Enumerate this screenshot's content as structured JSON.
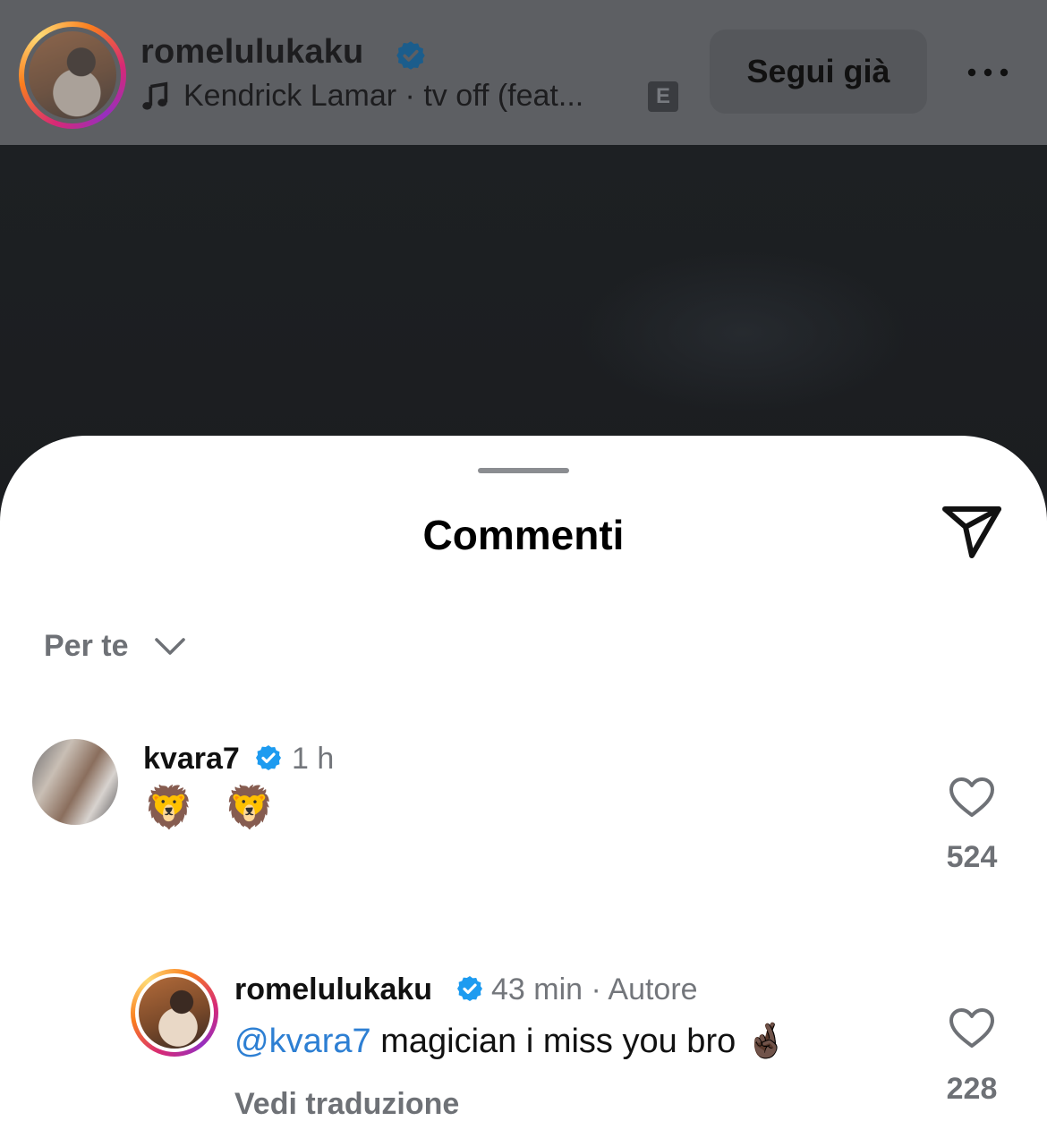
{
  "post": {
    "username": "romelulukaku",
    "music": "Kendrick Lamar · tv off (feat...",
    "explicit_badge": "E",
    "follow_label": "Segui già",
    "icons": [
      "verified-badge-icon",
      "music-note-icon",
      "more-options-icon"
    ]
  },
  "comments_sheet": {
    "title": "Commenti",
    "filter_label": "Per te",
    "comments": [
      {
        "username": "kvara7",
        "time": "1 h",
        "text": "🦁 🦁",
        "likes": "524"
      },
      {
        "username": "romelulukaku",
        "time": "43 min · Autore",
        "mention": "@kvara7",
        "text": " magician i miss you bro 🤞🏿",
        "likes": "228",
        "translate_label": "Vedi traduzione"
      }
    ]
  },
  "colors": {
    "verified_blue": "#1d9bf0",
    "mention_blue": "#2d7fd3",
    "muted_text": "#6e7176"
  }
}
